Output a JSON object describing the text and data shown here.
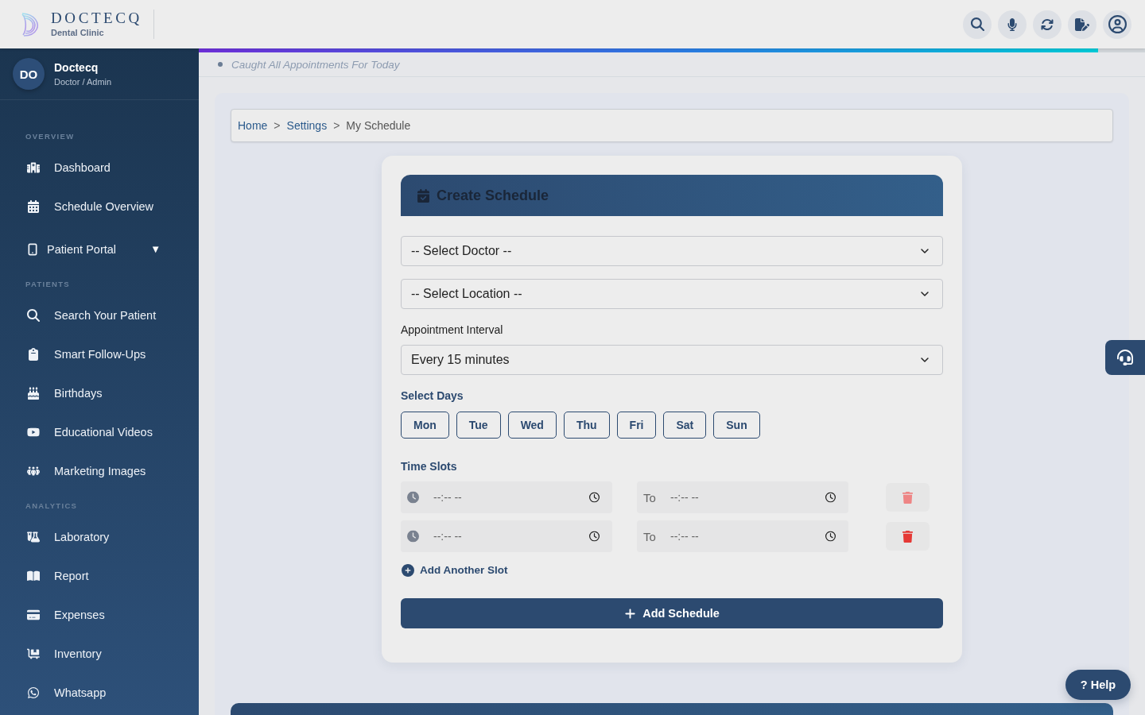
{
  "header": {
    "logo": {
      "name": "DOCTECQ",
      "subtitle": "Dental Clinic"
    }
  },
  "progress": {
    "level": 0.95
  },
  "notice": {
    "text": "Caught All Appointments For Today"
  },
  "sidebar": {
    "profile": {
      "initials": "DO",
      "name": "Doctecq",
      "role": "Doctor / Admin"
    },
    "sections": [
      {
        "title": "OVERVIEW",
        "items": [
          {
            "label": "Dashboard",
            "kind": "link"
          },
          {
            "label": "Schedule Overview",
            "kind": "link"
          },
          {
            "label": "Patient Portal",
            "kind": "dropdown",
            "caret": "▼",
            "expanded": false
          }
        ]
      },
      {
        "title": "PATIENTS",
        "items": [
          {
            "label": "Search Your Patient",
            "kind": "link"
          },
          {
            "label": "Smart Follow-Ups",
            "kind": "link"
          },
          {
            "label": "Birthdays",
            "kind": "link"
          },
          {
            "label": "Educational Videos",
            "kind": "link"
          },
          {
            "label": "Marketing Images",
            "kind": "link"
          }
        ]
      },
      {
        "title": "ANALYTICS",
        "items": [
          {
            "label": "Laboratory",
            "kind": "link"
          },
          {
            "label": "Report",
            "kind": "link"
          },
          {
            "label": "Expenses",
            "kind": "link"
          },
          {
            "label": "Inventory",
            "kind": "link"
          },
          {
            "label": "Whatsapp",
            "kind": "link"
          }
        ]
      }
    ]
  },
  "breadcrumb": [
    {
      "kind": "link",
      "label": "Home"
    },
    {
      "kind": "separator",
      "label": ">"
    },
    {
      "kind": "link",
      "label": "Settings"
    },
    {
      "kind": "separator",
      "label": ">"
    },
    {
      "kind": "current",
      "label": "My Schedule"
    }
  ],
  "form": {
    "title": "Create Schedule",
    "doctor_select": {
      "value": "-- Select Doctor --"
    },
    "location_select": {
      "value": "-- Select Location --"
    },
    "interval": {
      "label": "Appointment Interval",
      "value": "Every 15 minutes"
    },
    "days": {
      "label": "Select Days",
      "items": [
        {
          "label": "Mon",
          "selected": false
        },
        {
          "label": "Tue",
          "selected": false
        },
        {
          "label": "Wed",
          "selected": false
        },
        {
          "label": "Thu",
          "selected": false
        },
        {
          "label": "Fri",
          "selected": false
        },
        {
          "label": "Sat",
          "selected": false
        },
        {
          "label": "Sun",
          "selected": false
        }
      ]
    },
    "time_slots": {
      "label": "Time Slots",
      "rows": [
        {
          "from": {
            "placeholder": "--:-- --"
          },
          "to": {
            "prefix": "To",
            "placeholder": "--:-- --"
          },
          "delete": {
            "disabled": true
          }
        },
        {
          "from": {
            "placeholder": "--:-- --"
          },
          "to": {
            "prefix": "To",
            "placeholder": "--:-- --"
          },
          "delete": {
            "disabled": false
          }
        }
      ]
    },
    "add_slot": {
      "label": "Add Another Slot"
    },
    "submit": {
      "label": "Add Schedule"
    }
  },
  "help_button": {
    "label": "? Help"
  }
}
